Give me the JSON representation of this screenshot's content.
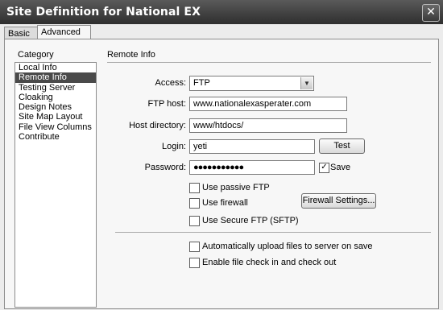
{
  "window": {
    "title": "Site Definition for National EX",
    "close_glyph": "✕"
  },
  "tabs": [
    {
      "label": "Basic"
    },
    {
      "label": "Advanced"
    }
  ],
  "category": {
    "header": "Category",
    "items": [
      {
        "label": "Local Info"
      },
      {
        "label": "Remote Info"
      },
      {
        "label": "Testing Server"
      },
      {
        "label": "Cloaking"
      },
      {
        "label": "Design Notes"
      },
      {
        "label": "Site Map Layout"
      },
      {
        "label": "File View Columns"
      },
      {
        "label": "Contribute"
      }
    ],
    "selected": "Remote Info"
  },
  "remote": {
    "section_title": "Remote Info",
    "access": {
      "label": "Access:",
      "value": "FTP",
      "arrow": "▼"
    },
    "ftp_host": {
      "label": "FTP host:",
      "value": "www.nationalexasperater.com"
    },
    "host_directory": {
      "label": "Host directory:",
      "value": "www/htdocs/"
    },
    "login": {
      "label": "Login:",
      "value": "yeti",
      "test_button": "Test"
    },
    "password": {
      "label": "Password:",
      "value": "●●●●●●●●●●●",
      "save_label": "Save",
      "save_checked": true,
      "check_glyph": "✓"
    },
    "use_passive_ftp": {
      "label": "Use passive FTP",
      "checked": false
    },
    "use_firewall": {
      "label": "Use firewall",
      "checked": false
    },
    "firewall_settings_button": "Firewall Settings...",
    "use_secure_ftp": {
      "label": "Use Secure FTP (SFTP)",
      "checked": false
    },
    "auto_upload": {
      "label": "Automatically upload files to server on save",
      "checked": false
    },
    "check_in_out": {
      "label": "Enable file check in and check out",
      "checked": false
    }
  }
}
